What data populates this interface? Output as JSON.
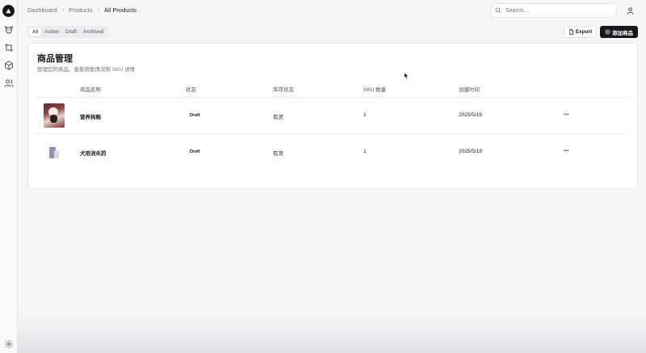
{
  "sidebar": {
    "logo": "triangle-logo",
    "items": [
      {
        "icon": "dog-icon"
      },
      {
        "icon": "crop-icon"
      },
      {
        "icon": "package-icon"
      },
      {
        "icon": "users-icon"
      }
    ],
    "settings_icon": "gear-icon"
  },
  "breadcrumb": [
    "Dashboard",
    "Products",
    "All Products"
  ],
  "search": {
    "placeholder": "Search..."
  },
  "tabs": [
    "All",
    "Active",
    "Draft",
    "Archived"
  ],
  "actions": {
    "export_label": "Export",
    "add_label": "添加商品"
  },
  "card": {
    "title": "商品管理",
    "description": "管理您的商品、查看销售情况和 SKU 详情"
  },
  "table": {
    "columns": [
      "商品名称",
      "状态",
      "库存状态",
      "SKU 数量",
      "创建时间"
    ],
    "rows": [
      {
        "name": "营养狗粮",
        "status": "Draft",
        "stock": "有货",
        "sku_count": "1",
        "created": "2025/5/19",
        "more": "···"
      },
      {
        "name": "犬用消炎药",
        "status": "Draft",
        "stock": "有货",
        "sku_count": "1",
        "created": "2025/5/19",
        "more": "···"
      }
    ]
  }
}
